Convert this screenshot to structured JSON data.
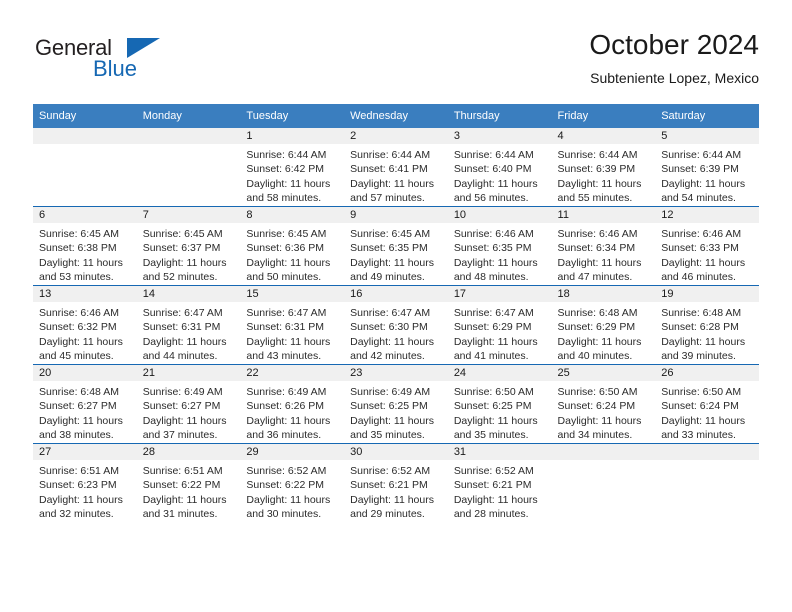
{
  "brand": {
    "name_part1": "General",
    "name_part2": "Blue",
    "accent_color": "#1668b3"
  },
  "header": {
    "title": "October 2024",
    "subtitle": "Subteniente Lopez, Mexico"
  },
  "calendar": {
    "header_bg": "#3a7ebf",
    "weekdays": [
      "Sunday",
      "Monday",
      "Tuesday",
      "Wednesday",
      "Thursday",
      "Friday",
      "Saturday"
    ],
    "weeks": [
      [
        {
          "day": "",
          "empty": true
        },
        {
          "day": "",
          "empty": true
        },
        {
          "day": "1",
          "sunrise": "Sunrise: 6:44 AM",
          "sunset": "Sunset: 6:42 PM",
          "daylight1": "Daylight: 11 hours",
          "daylight2": "and 58 minutes."
        },
        {
          "day": "2",
          "sunrise": "Sunrise: 6:44 AM",
          "sunset": "Sunset: 6:41 PM",
          "daylight1": "Daylight: 11 hours",
          "daylight2": "and 57 minutes."
        },
        {
          "day": "3",
          "sunrise": "Sunrise: 6:44 AM",
          "sunset": "Sunset: 6:40 PM",
          "daylight1": "Daylight: 11 hours",
          "daylight2": "and 56 minutes."
        },
        {
          "day": "4",
          "sunrise": "Sunrise: 6:44 AM",
          "sunset": "Sunset: 6:39 PM",
          "daylight1": "Daylight: 11 hours",
          "daylight2": "and 55 minutes."
        },
        {
          "day": "5",
          "sunrise": "Sunrise: 6:44 AM",
          "sunset": "Sunset: 6:39 PM",
          "daylight1": "Daylight: 11 hours",
          "daylight2": "and 54 minutes."
        }
      ],
      [
        {
          "day": "6",
          "sunrise": "Sunrise: 6:45 AM",
          "sunset": "Sunset: 6:38 PM",
          "daylight1": "Daylight: 11 hours",
          "daylight2": "and 53 minutes."
        },
        {
          "day": "7",
          "sunrise": "Sunrise: 6:45 AM",
          "sunset": "Sunset: 6:37 PM",
          "daylight1": "Daylight: 11 hours",
          "daylight2": "and 52 minutes."
        },
        {
          "day": "8",
          "sunrise": "Sunrise: 6:45 AM",
          "sunset": "Sunset: 6:36 PM",
          "daylight1": "Daylight: 11 hours",
          "daylight2": "and 50 minutes."
        },
        {
          "day": "9",
          "sunrise": "Sunrise: 6:45 AM",
          "sunset": "Sunset: 6:35 PM",
          "daylight1": "Daylight: 11 hours",
          "daylight2": "and 49 minutes."
        },
        {
          "day": "10",
          "sunrise": "Sunrise: 6:46 AM",
          "sunset": "Sunset: 6:35 PM",
          "daylight1": "Daylight: 11 hours",
          "daylight2": "and 48 minutes."
        },
        {
          "day": "11",
          "sunrise": "Sunrise: 6:46 AM",
          "sunset": "Sunset: 6:34 PM",
          "daylight1": "Daylight: 11 hours",
          "daylight2": "and 47 minutes."
        },
        {
          "day": "12",
          "sunrise": "Sunrise: 6:46 AM",
          "sunset": "Sunset: 6:33 PM",
          "daylight1": "Daylight: 11 hours",
          "daylight2": "and 46 minutes."
        }
      ],
      [
        {
          "day": "13",
          "sunrise": "Sunrise: 6:46 AM",
          "sunset": "Sunset: 6:32 PM",
          "daylight1": "Daylight: 11 hours",
          "daylight2": "and 45 minutes."
        },
        {
          "day": "14",
          "sunrise": "Sunrise: 6:47 AM",
          "sunset": "Sunset: 6:31 PM",
          "daylight1": "Daylight: 11 hours",
          "daylight2": "and 44 minutes."
        },
        {
          "day": "15",
          "sunrise": "Sunrise: 6:47 AM",
          "sunset": "Sunset: 6:31 PM",
          "daylight1": "Daylight: 11 hours",
          "daylight2": "and 43 minutes."
        },
        {
          "day": "16",
          "sunrise": "Sunrise: 6:47 AM",
          "sunset": "Sunset: 6:30 PM",
          "daylight1": "Daylight: 11 hours",
          "daylight2": "and 42 minutes."
        },
        {
          "day": "17",
          "sunrise": "Sunrise: 6:47 AM",
          "sunset": "Sunset: 6:29 PM",
          "daylight1": "Daylight: 11 hours",
          "daylight2": "and 41 minutes."
        },
        {
          "day": "18",
          "sunrise": "Sunrise: 6:48 AM",
          "sunset": "Sunset: 6:29 PM",
          "daylight1": "Daylight: 11 hours",
          "daylight2": "and 40 minutes."
        },
        {
          "day": "19",
          "sunrise": "Sunrise: 6:48 AM",
          "sunset": "Sunset: 6:28 PM",
          "daylight1": "Daylight: 11 hours",
          "daylight2": "and 39 minutes."
        }
      ],
      [
        {
          "day": "20",
          "sunrise": "Sunrise: 6:48 AM",
          "sunset": "Sunset: 6:27 PM",
          "daylight1": "Daylight: 11 hours",
          "daylight2": "and 38 minutes."
        },
        {
          "day": "21",
          "sunrise": "Sunrise: 6:49 AM",
          "sunset": "Sunset: 6:27 PM",
          "daylight1": "Daylight: 11 hours",
          "daylight2": "and 37 minutes."
        },
        {
          "day": "22",
          "sunrise": "Sunrise: 6:49 AM",
          "sunset": "Sunset: 6:26 PM",
          "daylight1": "Daylight: 11 hours",
          "daylight2": "and 36 minutes."
        },
        {
          "day": "23",
          "sunrise": "Sunrise: 6:49 AM",
          "sunset": "Sunset: 6:25 PM",
          "daylight1": "Daylight: 11 hours",
          "daylight2": "and 35 minutes."
        },
        {
          "day": "24",
          "sunrise": "Sunrise: 6:50 AM",
          "sunset": "Sunset: 6:25 PM",
          "daylight1": "Daylight: 11 hours",
          "daylight2": "and 35 minutes."
        },
        {
          "day": "25",
          "sunrise": "Sunrise: 6:50 AM",
          "sunset": "Sunset: 6:24 PM",
          "daylight1": "Daylight: 11 hours",
          "daylight2": "and 34 minutes."
        },
        {
          "day": "26",
          "sunrise": "Sunrise: 6:50 AM",
          "sunset": "Sunset: 6:24 PM",
          "daylight1": "Daylight: 11 hours",
          "daylight2": "and 33 minutes."
        }
      ],
      [
        {
          "day": "27",
          "sunrise": "Sunrise: 6:51 AM",
          "sunset": "Sunset: 6:23 PM",
          "daylight1": "Daylight: 11 hours",
          "daylight2": "and 32 minutes."
        },
        {
          "day": "28",
          "sunrise": "Sunrise: 6:51 AM",
          "sunset": "Sunset: 6:22 PM",
          "daylight1": "Daylight: 11 hours",
          "daylight2": "and 31 minutes."
        },
        {
          "day": "29",
          "sunrise": "Sunrise: 6:52 AM",
          "sunset": "Sunset: 6:22 PM",
          "daylight1": "Daylight: 11 hours",
          "daylight2": "and 30 minutes."
        },
        {
          "day": "30",
          "sunrise": "Sunrise: 6:52 AM",
          "sunset": "Sunset: 6:21 PM",
          "daylight1": "Daylight: 11 hours",
          "daylight2": "and 29 minutes."
        },
        {
          "day": "31",
          "sunrise": "Sunrise: 6:52 AM",
          "sunset": "Sunset: 6:21 PM",
          "daylight1": "Daylight: 11 hours",
          "daylight2": "and 28 minutes."
        },
        {
          "day": "",
          "empty": true
        },
        {
          "day": "",
          "empty": true
        }
      ]
    ]
  }
}
